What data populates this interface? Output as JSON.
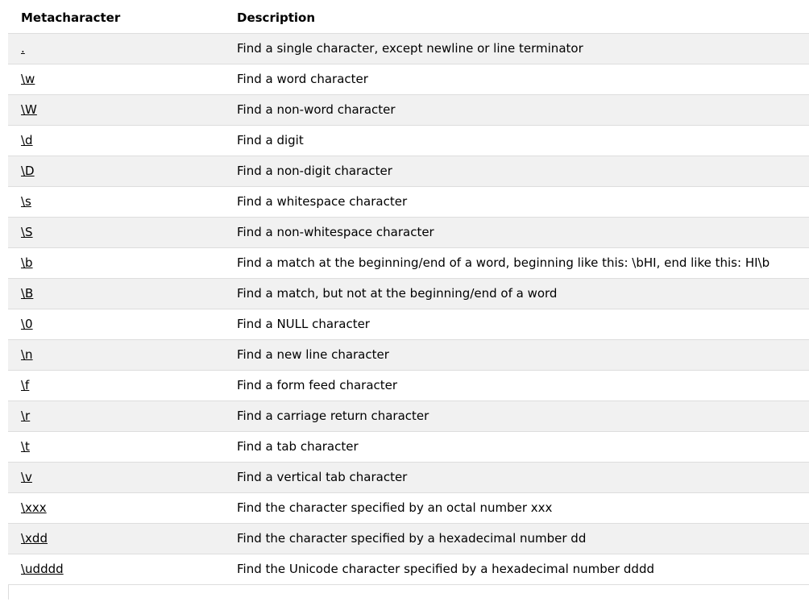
{
  "table": {
    "headers": {
      "metacharacter": "Metacharacter",
      "description": "Description"
    },
    "rows": [
      {
        "meta": ".",
        "desc": "Find a single character, except newline or line terminator"
      },
      {
        "meta": "\\w",
        "desc": "Find a word character"
      },
      {
        "meta": "\\W",
        "desc": "Find a non-word character"
      },
      {
        "meta": "\\d",
        "desc": "Find a digit"
      },
      {
        "meta": "\\D",
        "desc": "Find a non-digit character"
      },
      {
        "meta": "\\s",
        "desc": "Find a whitespace character"
      },
      {
        "meta": "\\S",
        "desc": "Find a non-whitespace character"
      },
      {
        "meta": "\\b",
        "desc": "Find a match at the beginning/end of a word, beginning like this: \\bHI, end like this: HI\\b"
      },
      {
        "meta": "\\B",
        "desc": "Find a match, but not at the beginning/end of a word"
      },
      {
        "meta": "\\0",
        "desc": "Find a NULL character"
      },
      {
        "meta": "\\n",
        "desc": "Find a new line character"
      },
      {
        "meta": "\\f",
        "desc": "Find a form feed character"
      },
      {
        "meta": "\\r",
        "desc": "Find a carriage return character"
      },
      {
        "meta": "\\t",
        "desc": "Find a tab character"
      },
      {
        "meta": "\\v",
        "desc": "Find a vertical tab character"
      },
      {
        "meta": "\\xxx",
        "desc": "Find the character specified by an octal number xxx"
      },
      {
        "meta": "\\xdd",
        "desc": "Find the character specified by a hexadecimal number dd"
      },
      {
        "meta": "\\udddd",
        "desc": "Find the Unicode character specified by a hexadecimal number dddd"
      }
    ]
  },
  "colors": {
    "stripe": "#f1f1f1",
    "border": "#dddddd",
    "text": "#000000"
  }
}
